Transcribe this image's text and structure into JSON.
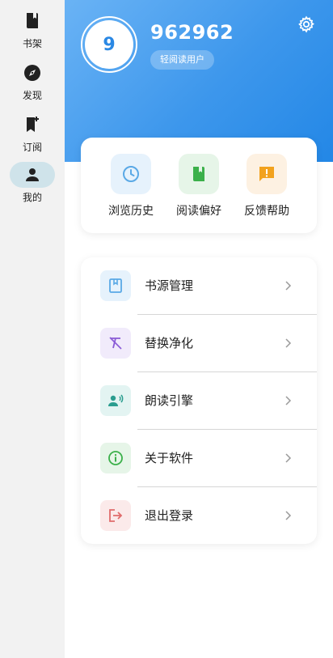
{
  "nav": {
    "items": [
      {
        "label": "书架",
        "icon": "book-icon"
      },
      {
        "label": "发现",
        "icon": "compass-icon"
      },
      {
        "label": "订阅",
        "icon": "bookmark-add-icon"
      },
      {
        "label": "我的",
        "icon": "person-icon",
        "active": true
      }
    ]
  },
  "profile": {
    "avatar_text": "9",
    "username": "962962",
    "badge": "轻阅读用户"
  },
  "quick_actions": [
    {
      "label": "浏览历史",
      "icon": "clock-icon",
      "color": "#5aa9e6"
    },
    {
      "label": "阅读偏好",
      "icon": "book-icon",
      "color": "#3bb04a"
    },
    {
      "label": "反馈帮助",
      "icon": "feedback-icon",
      "color": "#f2a21e"
    }
  ],
  "menu": [
    {
      "label": "书源管理",
      "icon": "book-source-icon",
      "color": "#5aa9e6"
    },
    {
      "label": "替换净化",
      "icon": "clear-format-icon",
      "color": "#8a5bd6"
    },
    {
      "label": "朗读引擎",
      "icon": "voice-icon",
      "color": "#2a9d8f"
    },
    {
      "label": "关于软件",
      "icon": "info-icon",
      "color": "#3bb04a"
    },
    {
      "label": "退出登录",
      "icon": "logout-icon",
      "color": "#e06c6c"
    }
  ],
  "colors": {
    "accent": "#2a88e4",
    "header_gradient_start": "#6ab3f5",
    "header_gradient_end": "#2387e6",
    "rail_bg": "#f2f2f2",
    "rail_active": "#cfe3ea"
  }
}
